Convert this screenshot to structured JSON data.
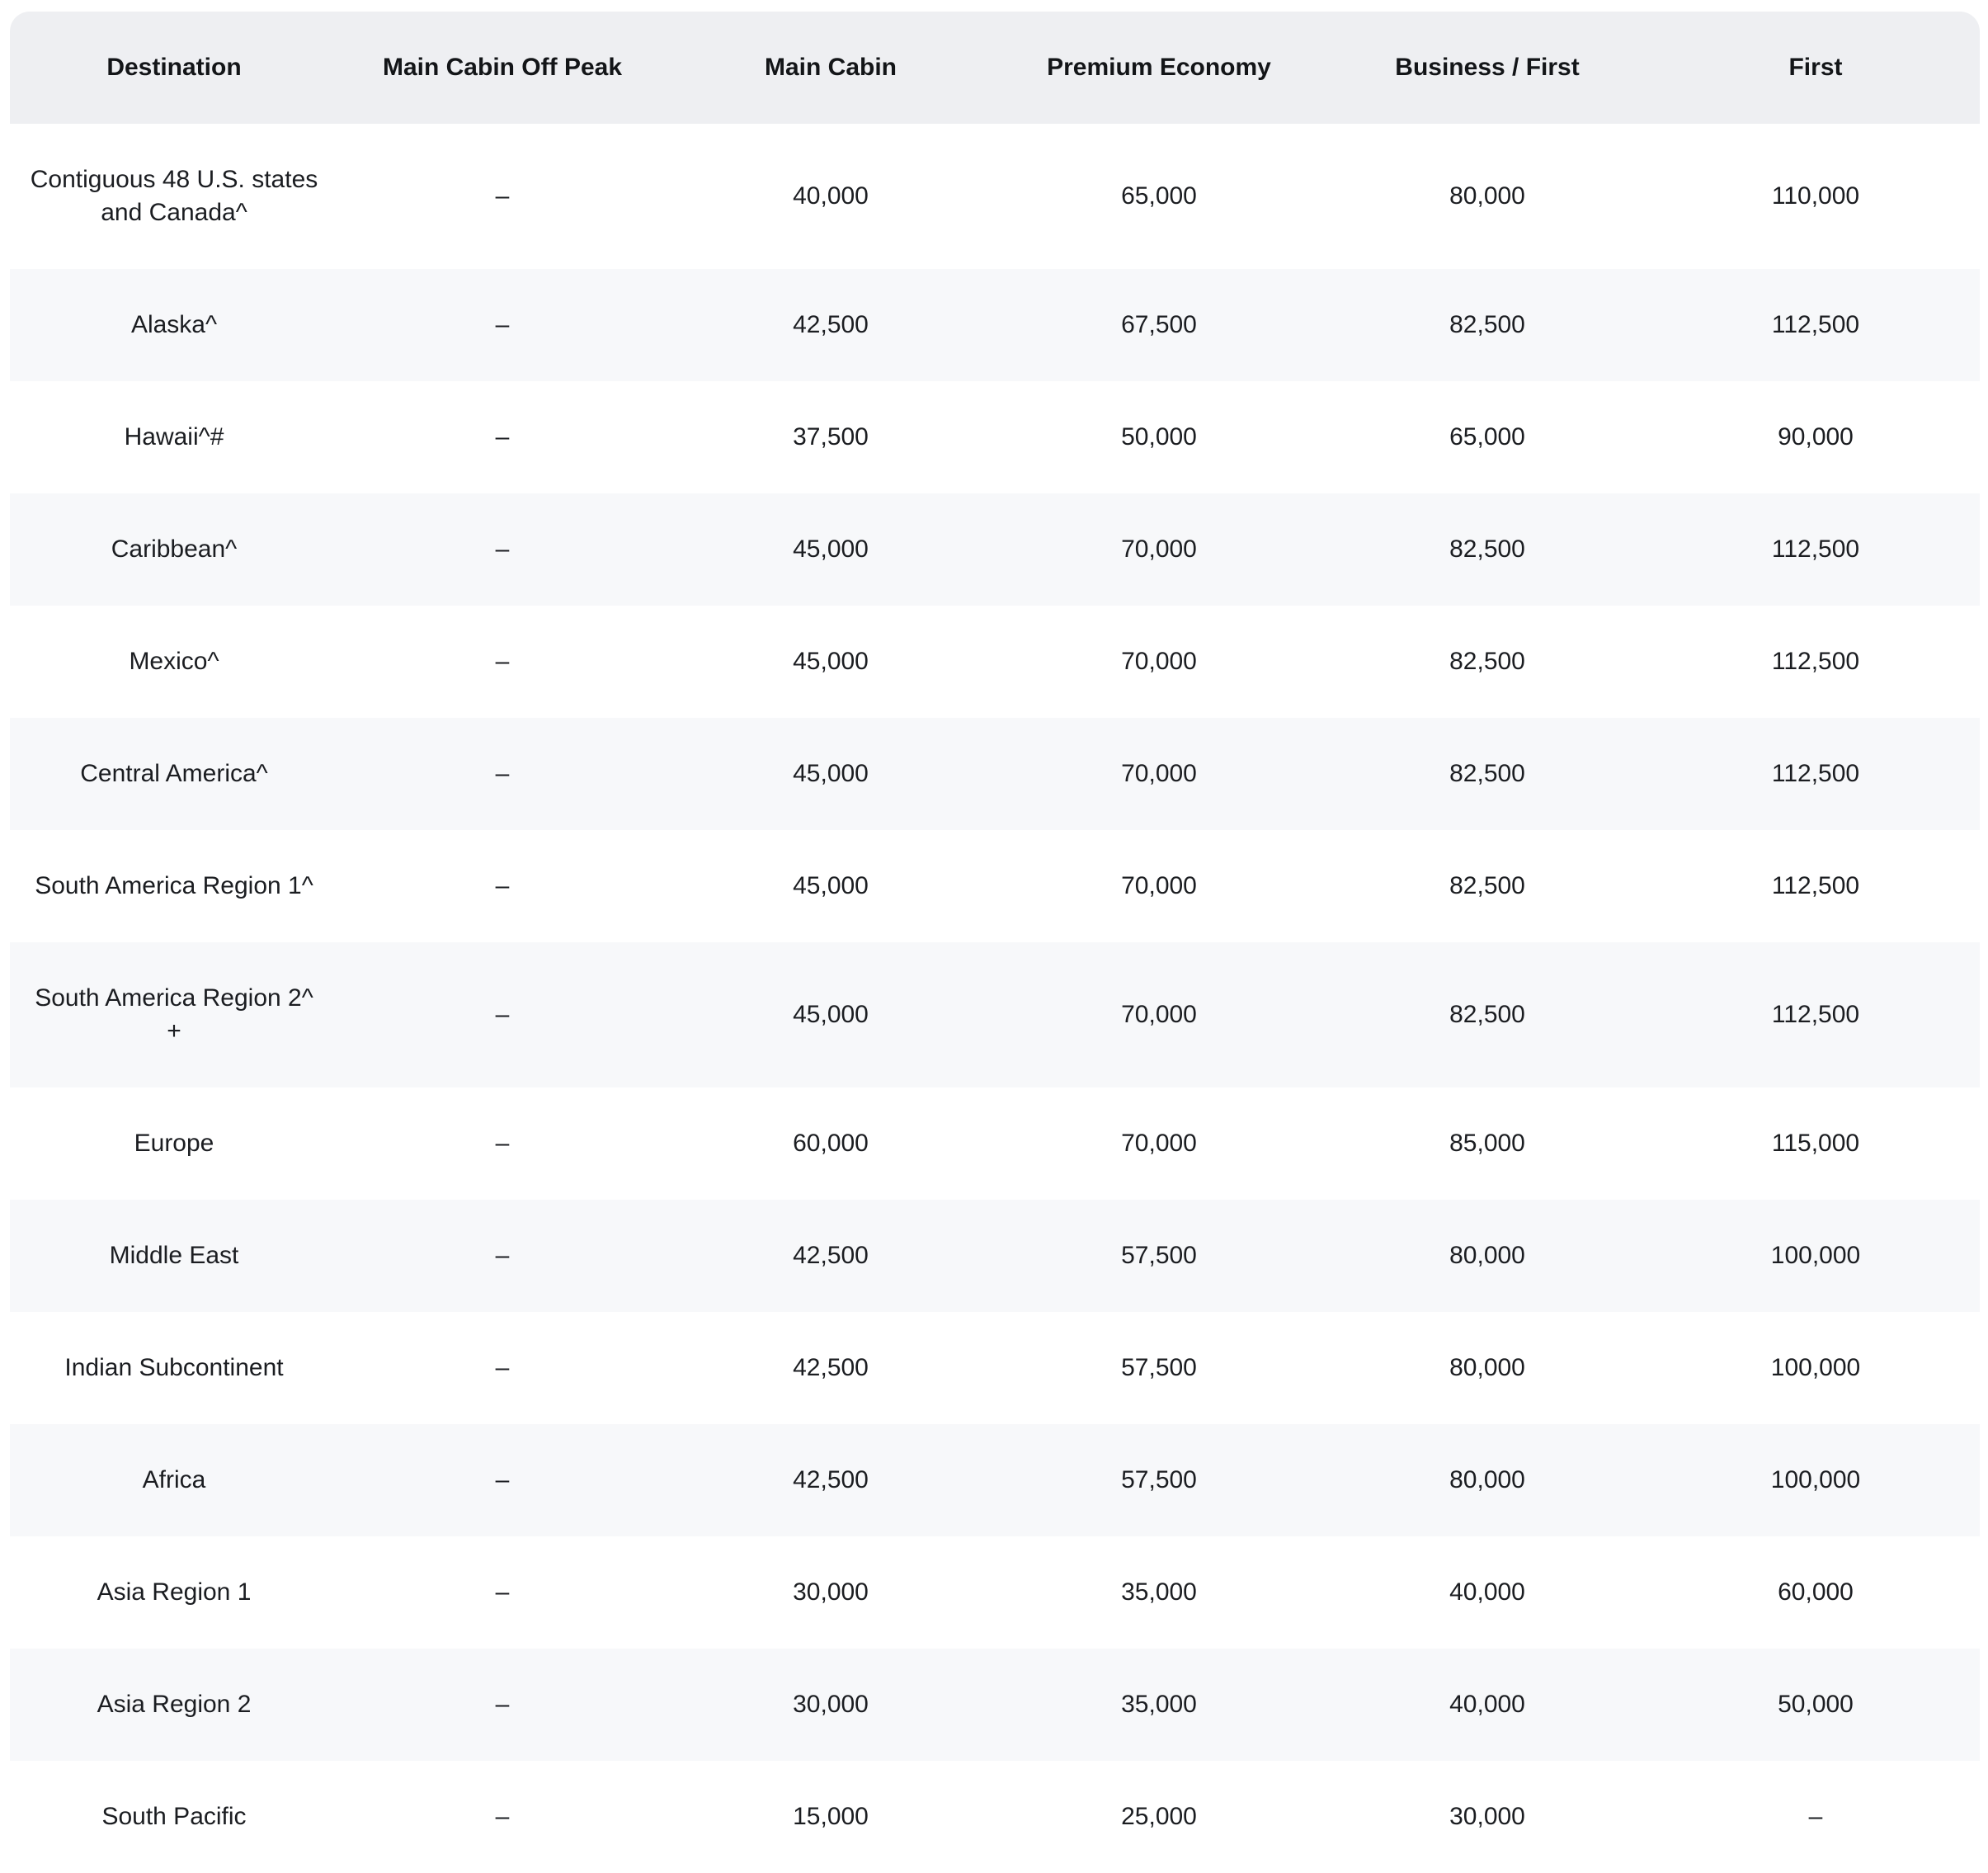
{
  "table": {
    "headers": [
      "Destination",
      "Main Cabin Off Peak",
      "Main Cabin",
      "Premium Economy",
      "Business / First",
      "First"
    ],
    "rows": [
      {
        "destination": "Contiguous 48 U.S. states and Canada^",
        "off_peak": "–",
        "main_cabin": "40,000",
        "premium_economy": "65,000",
        "business_first": "80,000",
        "first": "110,000"
      },
      {
        "destination": "Alaska^",
        "off_peak": "–",
        "main_cabin": "42,500",
        "premium_economy": "67,500",
        "business_first": "82,500",
        "first": "112,500"
      },
      {
        "destination": "Hawaii^#",
        "off_peak": "–",
        "main_cabin": "37,500",
        "premium_economy": "50,000",
        "business_first": "65,000",
        "first": "90,000"
      },
      {
        "destination": "Caribbean^",
        "off_peak": "–",
        "main_cabin": "45,000",
        "premium_economy": "70,000",
        "business_first": "82,500",
        "first": "112,500"
      },
      {
        "destination": "Mexico^",
        "off_peak": "–",
        "main_cabin": "45,000",
        "premium_economy": "70,000",
        "business_first": "82,500",
        "first": "112,500"
      },
      {
        "destination": "Central America^",
        "off_peak": "–",
        "main_cabin": "45,000",
        "premium_economy": "70,000",
        "business_first": "82,500",
        "first": "112,500"
      },
      {
        "destination": "South America Region 1^",
        "off_peak": "–",
        "main_cabin": "45,000",
        "premium_economy": "70,000",
        "business_first": "82,500",
        "first": "112,500"
      },
      {
        "destination": "South America Region 2^ +",
        "off_peak": "–",
        "main_cabin": "45,000",
        "premium_economy": "70,000",
        "business_first": "82,500",
        "first": "112,500"
      },
      {
        "destination": "Europe",
        "off_peak": "–",
        "main_cabin": "60,000",
        "premium_economy": "70,000",
        "business_first": "85,000",
        "first": "115,000"
      },
      {
        "destination": "Middle East",
        "off_peak": "–",
        "main_cabin": "42,500",
        "premium_economy": "57,500",
        "business_first": "80,000",
        "first": "100,000"
      },
      {
        "destination": "Indian Subcontinent",
        "off_peak": "–",
        "main_cabin": "42,500",
        "premium_economy": "57,500",
        "business_first": "80,000",
        "first": "100,000"
      },
      {
        "destination": "Africa",
        "off_peak": "–",
        "main_cabin": "42,500",
        "premium_economy": "57,500",
        "business_first": "80,000",
        "first": "100,000"
      },
      {
        "destination": "Asia Region 1",
        "off_peak": "–",
        "main_cabin": "30,000",
        "premium_economy": "35,000",
        "business_first": "40,000",
        "first": "60,000"
      },
      {
        "destination": "Asia Region 2",
        "off_peak": "–",
        "main_cabin": "30,000",
        "premium_economy": "35,000",
        "business_first": "40,000",
        "first": "50,000"
      },
      {
        "destination": "South Pacific",
        "off_peak": "–",
        "main_cabin": "15,000",
        "premium_economy": "25,000",
        "business_first": "30,000",
        "first": "–"
      }
    ]
  }
}
